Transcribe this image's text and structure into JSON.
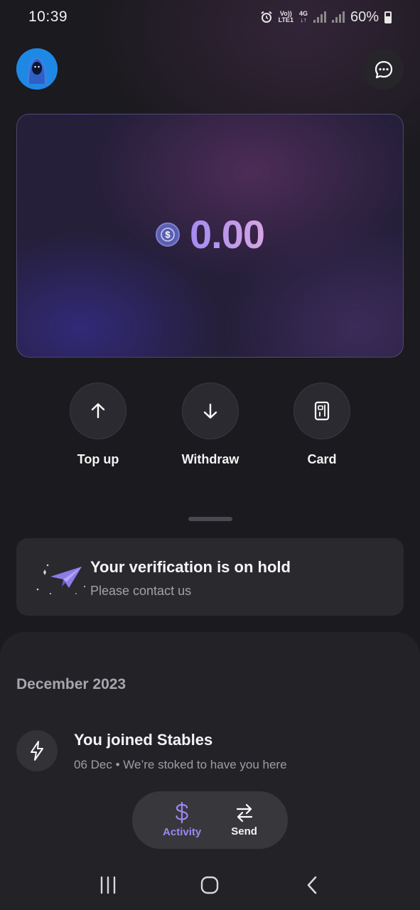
{
  "status_bar": {
    "time": "10:39",
    "volte_top": "Vo))",
    "volte_bottom": "LTE1",
    "network_top": "4G",
    "network_bottom": "↓↑",
    "battery": "60%",
    "icons": [
      "alarm-icon",
      "signal-icon",
      "signal-icon",
      "battery-icon"
    ]
  },
  "header": {
    "avatar_icon": "ghost-avatar-icon",
    "chat_icon": "chat-bubble-icon"
  },
  "balance": {
    "currency_icon": "usdc-dollar-icon",
    "amount": "0.00"
  },
  "actions": [
    {
      "label": "Top up",
      "icon": "arrow-up-icon"
    },
    {
      "label": "Withdraw",
      "icon": "arrow-down-icon"
    },
    {
      "label": "Card",
      "icon": "card-icon"
    }
  ],
  "verification": {
    "title": "Your verification is on hold",
    "subtitle": "Please contact us",
    "icon": "paper-plane-icon"
  },
  "activity": {
    "month": "December 2023",
    "items": [
      {
        "title": "You joined Stables",
        "subtitle": "06 Dec • We’re stoked to have you here",
        "icon": "lightning-icon"
      }
    ]
  },
  "tab_bar": {
    "tabs": [
      {
        "label": "Activity",
        "icon": "dollar-icon",
        "active": true
      },
      {
        "label": "Send",
        "icon": "swap-arrows-icon",
        "active": false
      }
    ]
  },
  "system_nav": {
    "buttons": [
      "recents-icon",
      "home-icon",
      "back-icon"
    ]
  },
  "colors": {
    "background": "#1b1a1e",
    "accent": "#9c87f0",
    "avatar": "#1e88e5"
  }
}
